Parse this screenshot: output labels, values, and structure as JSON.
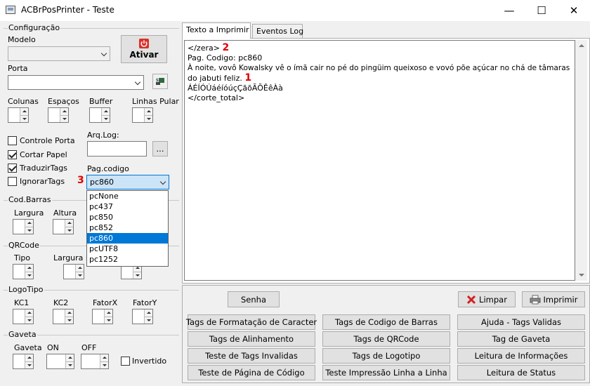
{
  "window": {
    "title": "ACBrPosPrinter - Teste",
    "minimize": "—",
    "maximize": "☐",
    "close": "✕"
  },
  "left": {
    "configuracao": "Configuração",
    "modelo_label": "Modelo",
    "ativar_label": "Ativar",
    "porta_label": "Porta",
    "colunas_label": "Colunas",
    "espacos_label": "Espaços",
    "buffer_label": "Buffer",
    "linhas_pular_label": "Linhas Pular",
    "controle_porta": "Controle Porta",
    "cortar_papel": "Cortar Papel",
    "traduzir_tags": "TraduzirTags",
    "ignorar_tags": "IgnorarTags",
    "arq_log_label": "Arq.Log:",
    "browse_label": "...",
    "pag_codigo_label": "Pag.codigo",
    "pag_codigo_value": "pc860",
    "pag_codigo_options": [
      "pcNone",
      "pc437",
      "pc850",
      "pc852",
      "pc860",
      "pcUTF8",
      "pc1252"
    ],
    "pag_codigo_selected_index": 4,
    "cod_barras": "Cod.Barras",
    "largura_label": "Largura",
    "altura_label": "Altura",
    "qrcode": "QRCode",
    "tipo_label": "Tipo",
    "largura_m_label": "Largura M",
    "logotipo": "LogoTipo",
    "kc1_label": "KC1",
    "kc2_label": "KC2",
    "fatorx_label": "FatorX",
    "fatory_label": "FatorY",
    "gaveta": "Gaveta",
    "gaveta_label": "Gaveta",
    "on_label": "ON",
    "off_label": "OFF",
    "invertido": "Invertido"
  },
  "checkbox_states": {
    "controle_porta": false,
    "cortar_papel": true,
    "traduzir_tags": true,
    "ignorar_tags": false,
    "invertido": false
  },
  "tabs": [
    "Texto a Imprimir",
    "Eventos Log"
  ],
  "memo": {
    "line1": "</zera>",
    "line2": "Pag. Codigo: pc860",
    "line3": "À noite, vovô Kowalsky vê o ímã cair no pé do pingüim queixoso e vovó põe açúcar no chá de tâmaras",
    "line4": "do jabuti feliz.",
    "line5": "ÁÉÍÓÚáéíóúçÇãõÃÕÊêÀà",
    "line6": "</corte_total>"
  },
  "markers": {
    "m1": "1",
    "m2": "2",
    "m3": "3"
  },
  "buttons": {
    "senha": "Senha",
    "limpar": "Limpar",
    "imprimir": "Imprimir",
    "grid": [
      "Tags de Formatação de Caracter",
      "Tags de Codigo de Barras",
      "Ajuda - Tags Validas",
      "Tags de Alinhamento",
      "Tags de QRCode",
      "Tag de Gaveta",
      "Teste de Tags Invalidas",
      "Tags de Logotipo",
      "Leitura de Informações",
      "Teste de Página de Código",
      "Teste Impressão Linha a Linha",
      "Leitura de Status"
    ]
  },
  "colors": {
    "selection": "#0078d7",
    "marker": "#e00000",
    "power_icon": "#d9302a",
    "limpar_icon": "#d42020"
  }
}
